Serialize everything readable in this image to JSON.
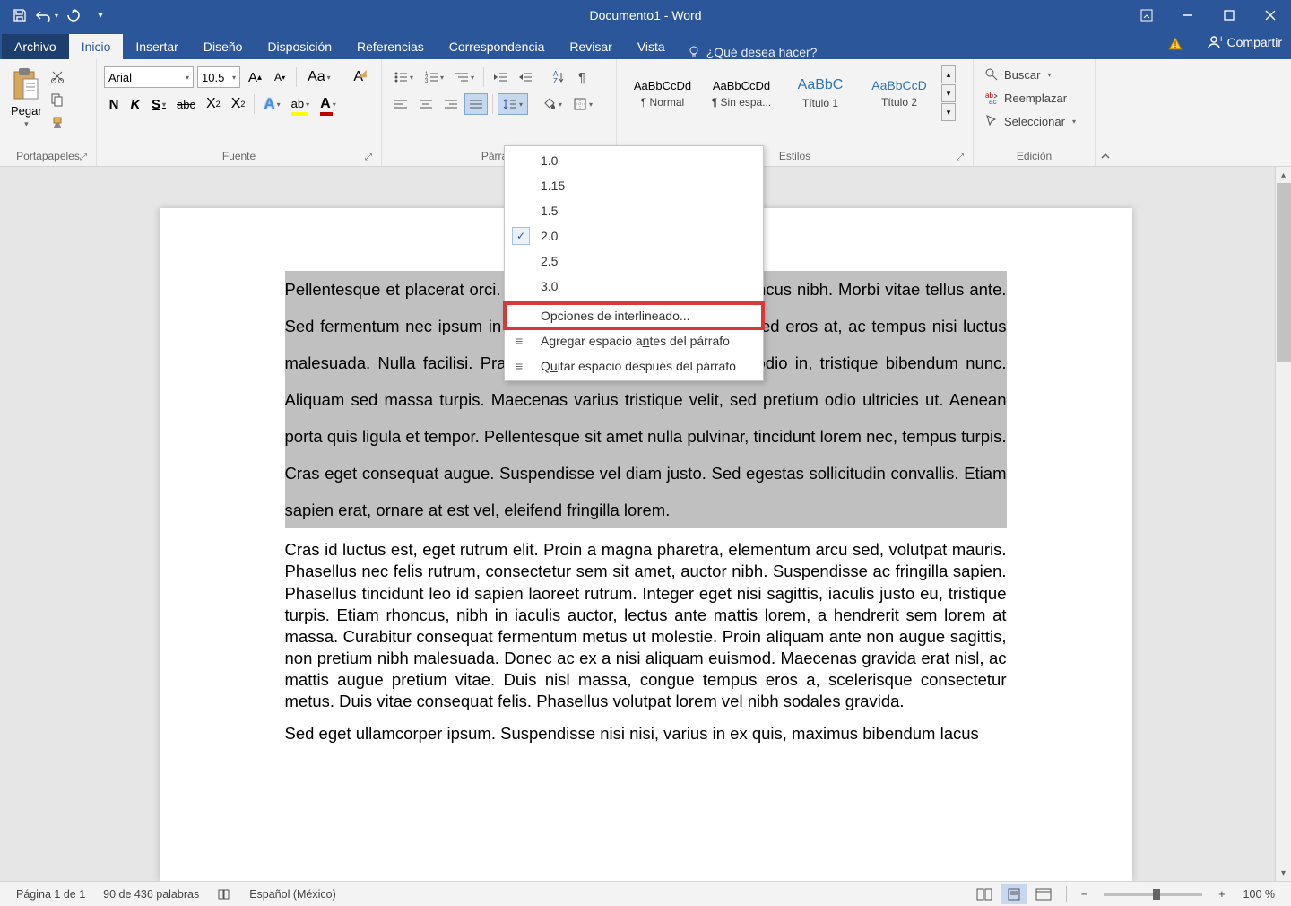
{
  "titlebar": {
    "document_title": "Documento1 - Word"
  },
  "tabs": {
    "archivo": "Archivo",
    "inicio": "Inicio",
    "insertar": "Insertar",
    "diseno": "Diseño",
    "disposicion": "Disposición",
    "referencias": "Referencias",
    "correspondencia": "Correspondencia",
    "revisar": "Revisar",
    "vista": "Vista",
    "tell_me": "¿Qué desea hacer?",
    "share": "Compartir"
  },
  "ribbon": {
    "portapapeles": {
      "label": "Portapapeles",
      "pegar": "Pegar"
    },
    "fuente": {
      "label": "Fuente",
      "font_name": "Arial",
      "font_size": "10.5"
    },
    "parrafo": {
      "label": "Párrafo"
    },
    "estilos": {
      "label": "Estilos",
      "items": [
        {
          "preview": "AaBbCcDd",
          "name": "¶ Normal"
        },
        {
          "preview": "AaBbCcDd",
          "name": "¶ Sin espa..."
        },
        {
          "preview": "AaBbC",
          "name": "Título 1"
        },
        {
          "preview": "AaBbCcD",
          "name": "Título 2"
        }
      ]
    },
    "edicion": {
      "label": "Edición",
      "buscar": "Buscar",
      "reemplazar": "Reemplazar",
      "seleccionar": "Seleccionar"
    }
  },
  "line_spacing_menu": {
    "v1": "1.0",
    "v2": "1.15",
    "v3": "1.5",
    "v4": "2.0",
    "v5": "2.5",
    "v6": "3.0",
    "opciones": "Opciones de interlineado...",
    "agregar_pre": "Agregar espacio a",
    "agregar_n": "n",
    "agregar_post": "tes del párrafo",
    "quitar_pre": "Q",
    "quitar_u": "u",
    "quitar_post": "itar espacio después del párrafo"
  },
  "document": {
    "p1": "Pellentesque et placerat orci. Curabitur id rhoncus purus, et rhoncus nibh. Morbi vitae tellus ante. Sed fermentum nec ipsum in egestas. Integer mi enim, luctus sed eros at, ac tempus nisi luctus malesuada. Nulla facilisi. Praesent urna nunc, consectetur in odio in, tristique bibendum nunc. Aliquam sed massa turpis. Maecenas varius tristique velit, sed pretium odio ultricies ut. Aenean porta quis ligula et tempor. Pellentesque sit amet nulla pulvinar, tincidunt lorem nec, tempus turpis. Cras eget consequat augue. Suspendisse vel diam justo. Sed egestas sollicitudin convallis. Etiam sapien erat, ornare at est vel, eleifend fringilla lorem.",
    "p2": "Cras id luctus est, eget rutrum elit. Proin a magna pharetra, elementum arcu sed, volutpat mauris. Phasellus nec felis rutrum, consectetur sem sit amet, auctor nibh. Suspendisse ac fringilla sapien. Phasellus tincidunt leo id sapien laoreet rutrum. Integer eget nisi sagittis, iaculis justo eu, tristique turpis. Etiam rhoncus, nibh in iaculis auctor, lectus ante mattis lorem, a hendrerit sem lorem at massa. Curabitur consequat fermentum metus ut molestie. Proin aliquam ante non augue sagittis, non pretium nibh malesuada. Donec ac ex a nisi aliquam euismod. Maecenas gravida erat nisl, ac mattis augue pretium vitae. Duis nisl massa, congue tempus eros a, scelerisque consectetur metus. Duis vitae consequat felis. Phasellus volutpat lorem vel nibh sodales gravida.",
    "p3": "Sed eget ullamcorper ipsum. Suspendisse nisi nisi, varius in ex quis, maximus bibendum lacus"
  },
  "statusbar": {
    "page": "Página 1 de 1",
    "words": "90 de 436 palabras",
    "language": "Español (México)",
    "zoom": "100 %"
  }
}
